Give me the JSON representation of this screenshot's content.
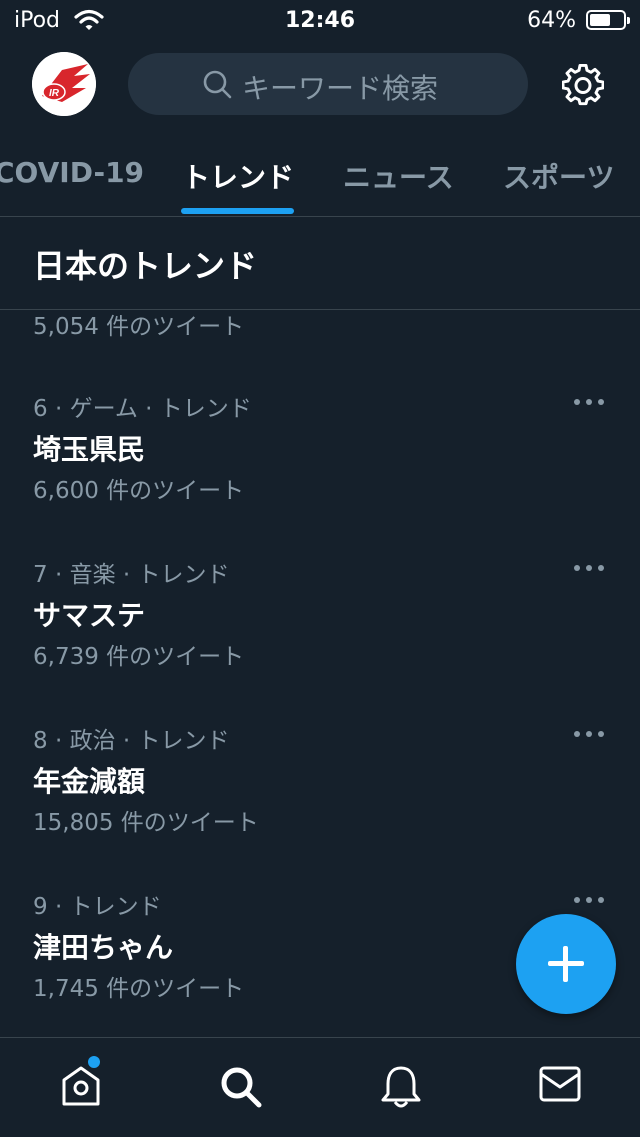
{
  "status_bar": {
    "carrier": "iPod",
    "time": "12:46",
    "battery_percent": "64%",
    "battery_level": 0.64
  },
  "header": {
    "avatar_text": "IR",
    "search_placeholder": "キーワード検索"
  },
  "tabs": [
    {
      "label": "COVID-19",
      "active": false
    },
    {
      "label": "トレンド",
      "active": true
    },
    {
      "label": "ニュース",
      "active": false
    },
    {
      "label": "スポーツ",
      "active": false
    }
  ],
  "section": {
    "title": "日本のトレンド"
  },
  "partial_trend": {
    "count": "5,054 件のツイート"
  },
  "trends": [
    {
      "meta": "6 · ゲーム · トレンド",
      "name": "埼玉県民",
      "count": "6,600 件のツイート"
    },
    {
      "meta": "7 · 音楽 · トレンド",
      "name": "サマステ",
      "count": "6,739 件のツイート"
    },
    {
      "meta": "8 · 政治 · トレンド",
      "name": "年金減額",
      "count": "15,805 件のツイート"
    },
    {
      "meta": "9 · トレンド",
      "name": "津田ちゃん",
      "count": "1,745 件のツイート"
    }
  ],
  "icons": {
    "home": "home-icon",
    "search": "search-icon",
    "notifications": "bell-icon",
    "messages": "mail-icon",
    "settings": "gear-icon",
    "compose": "plus-icon"
  },
  "colors": {
    "background": "#15202b",
    "accent": "#1da1f2",
    "secondary_text": "#8899a6",
    "divider": "#38444d"
  }
}
